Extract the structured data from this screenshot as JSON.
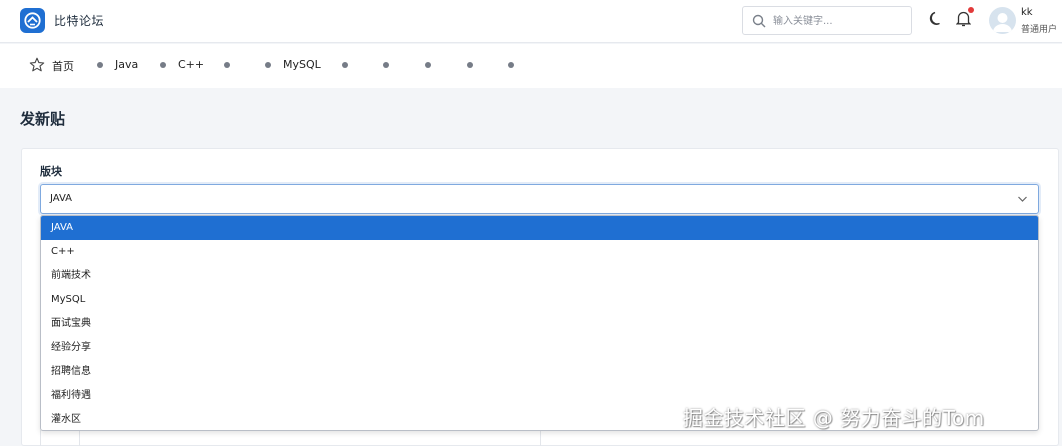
{
  "header": {
    "app_title": "比特论坛",
    "search_placeholder": "输入关键字...",
    "user_name": "kk",
    "user_role": "普通用户",
    "brand_color": "#1f6fd2",
    "notification_dot_color": "#e23a3a"
  },
  "nav": {
    "home_label": "首页",
    "items": [
      {
        "label": "Java"
      },
      {
        "label": "C++"
      },
      {
        "label": ""
      },
      {
        "label": "MySQL"
      },
      {
        "label": ""
      },
      {
        "label": ""
      },
      {
        "label": ""
      },
      {
        "label": ""
      },
      {
        "label": ""
      }
    ]
  },
  "page": {
    "title": "发新贴",
    "board_label": "版块",
    "board_selected": "JAVA",
    "board_options": [
      "JAVA",
      "C++",
      "前端技术",
      "MySQL",
      "面试宝典",
      "经验分享",
      "招聘信息",
      "福利待遇",
      "灌水区"
    ]
  },
  "watermark": "掘金技术社区 @ 努力奋斗的Tom"
}
